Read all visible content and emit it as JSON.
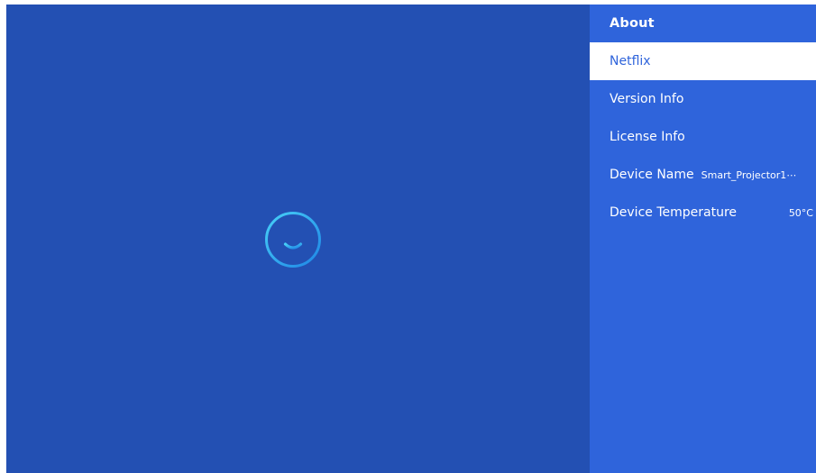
{
  "panel": {
    "title": "About",
    "items": [
      {
        "label": "Netflix",
        "value": "",
        "selected": true
      },
      {
        "label": "Version Info",
        "value": ""
      },
      {
        "label": "License Info",
        "value": ""
      },
      {
        "label": "Device Name",
        "value": "Smart_Projector1⋯"
      },
      {
        "label": "Device Temperature",
        "value": "50°C"
      }
    ]
  },
  "icons": {
    "main_logo": "smiley-power-icon"
  },
  "colors": {
    "background": "#2350b3",
    "panel_background": "#2f64db",
    "selected_background": "#ffffff",
    "selected_text": "#2f64db",
    "logo_gradient_start": "#3ec6f5",
    "logo_gradient_end": "#1f8fe8"
  }
}
